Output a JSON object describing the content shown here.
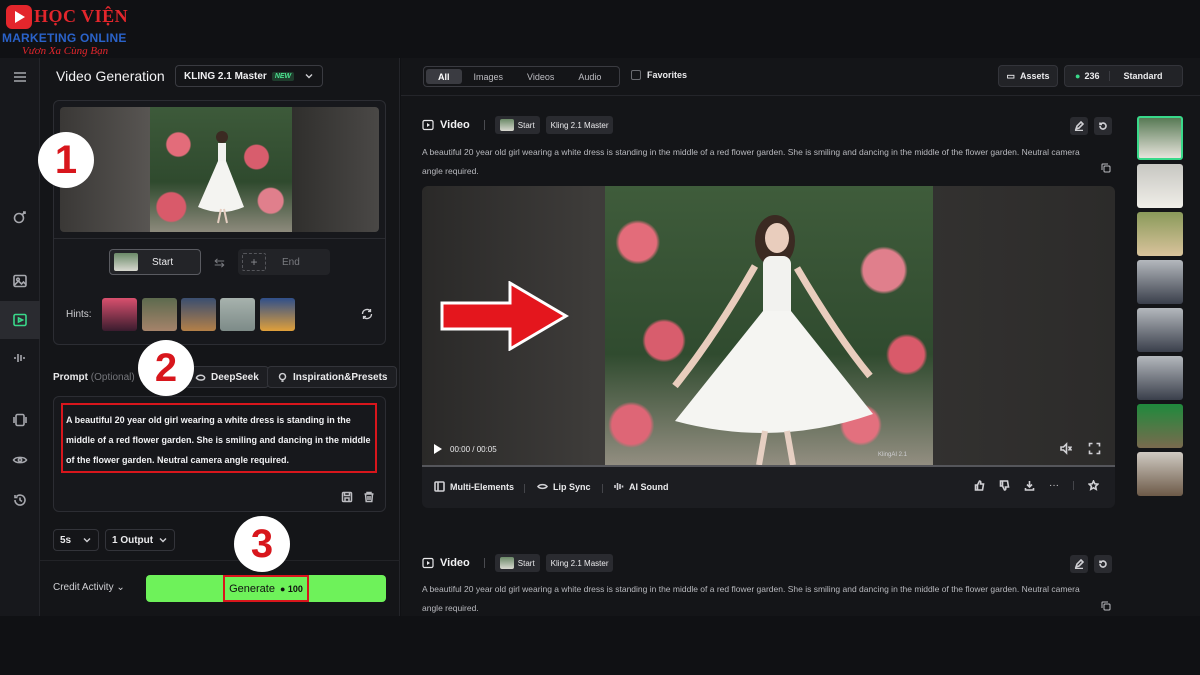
{
  "logo": {
    "line1": "HỌC VIỆN",
    "line2": "MARKETING ONLINE",
    "line3": "Vươn Xa Cùng Bạn"
  },
  "left_panel": {
    "title": "Video Generation",
    "model": "KLING 2.1 Master",
    "model_badge": "NEW",
    "frames": {
      "start_label": "Start",
      "end_label": "End"
    },
    "hints_label": "Hints:",
    "prompt": {
      "label": "Prompt",
      "optional": "(Optional)",
      "deepseek_label": "DeepSeek",
      "inspiration_label": "Inspiration&Presets",
      "text": "A beautiful 20 year old girl wearing a white dress is standing in the middle of a red flower garden. She is smiling and dancing in the middle of the flower garden. Neutral camera angle required."
    },
    "duration": "5s",
    "outputs": "1 Output",
    "credit_activity": "Credit Activity",
    "generate_label": "Generate",
    "generate_cost": "100"
  },
  "steps": [
    "1",
    "2",
    "3"
  ],
  "main": {
    "filters": [
      "All",
      "Images",
      "Videos",
      "Audio"
    ],
    "active_filter": "All",
    "favorites_label": "Favorites",
    "assets_label": "Assets",
    "credits": "236",
    "plan": "Standard",
    "cards": [
      {
        "label": "Video",
        "start_tag": "Start",
        "model_tag": "Kling 2.1 Master",
        "description": "A beautiful 20 year old girl wearing a white dress is standing in the middle of a red flower garden. She is smiling and dancing in the middle of the flower garden. Neutral camera angle required.",
        "time": "00:00 / 00:05",
        "watermark": "KlingAI 2.1",
        "actions": [
          "Multi-Elements",
          "Lip Sync",
          "AI Sound"
        ]
      },
      {
        "label": "Video",
        "start_tag": "Start",
        "model_tag": "Kling 2.1 Master",
        "description": "A beautiful 20 year old girl wearing a white dress is standing in the middle of a red flower garden. She is smiling and dancing in the middle of the flower garden. Neutral camera angle required."
      }
    ]
  },
  "colors": {
    "accent_green": "#39d98a",
    "generate_green": "#6ef25a",
    "highlight_red": "#d8161c"
  }
}
